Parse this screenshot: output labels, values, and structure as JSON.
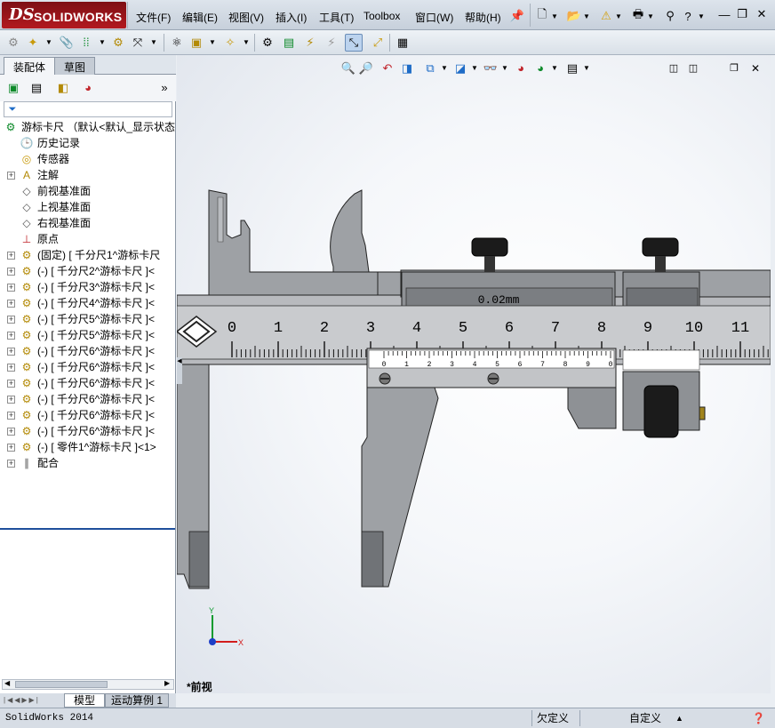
{
  "app": {
    "brand_prefix": "DS",
    "brand_name": "SOLIDWORKS"
  },
  "menu": [
    "文件(F)",
    "编辑(E)",
    "视图(V)",
    "插入(I)",
    "工具(T)",
    "Toolbox",
    "窗口(W)",
    "帮助(H)"
  ],
  "panel_tabs": [
    "装配体",
    "草图"
  ],
  "tree": {
    "root": "游标卡尺  （默认<默认_显示状态",
    "items": [
      {
        "label": "历史记录",
        "icon": "history-icon"
      },
      {
        "label": "传感器",
        "icon": "sensor-icon"
      },
      {
        "label": "注解",
        "icon": "annotation-icon"
      },
      {
        "label": "前视基准面",
        "icon": "plane-icon"
      },
      {
        "label": "上视基准面",
        "icon": "plane-icon"
      },
      {
        "label": "右视基准面",
        "icon": "plane-icon"
      },
      {
        "label": "原点",
        "icon": "origin-icon"
      },
      {
        "label": "(固定) [ 千分尺1^游标卡尺",
        "icon": "part-icon"
      },
      {
        "label": "(-) [ 千分尺2^游标卡尺 ]<",
        "icon": "part-icon"
      },
      {
        "label": "(-) [ 千分尺3^游标卡尺 ]<",
        "icon": "part-icon"
      },
      {
        "label": "(-) [ 千分尺4^游标卡尺 ]<",
        "icon": "part-icon"
      },
      {
        "label": "(-) [ 千分尺5^游标卡尺 ]<",
        "icon": "part-icon"
      },
      {
        "label": "(-) [ 千分尺5^游标卡尺 ]<",
        "icon": "part-icon"
      },
      {
        "label": "(-) [ 千分尺6^游标卡尺 ]<",
        "icon": "part-icon"
      },
      {
        "label": "(-) [ 千分尺6^游标卡尺 ]<",
        "icon": "part-icon"
      },
      {
        "label": "(-) [ 千分尺6^游标卡尺 ]<",
        "icon": "part-icon"
      },
      {
        "label": "(-) [ 千分尺6^游标卡尺 ]<",
        "icon": "part-icon"
      },
      {
        "label": "(-) [ 千分尺6^游标卡尺 ]<",
        "icon": "part-icon"
      },
      {
        "label": "(-) [ 千分尺6^游标卡尺 ]<",
        "icon": "part-icon"
      },
      {
        "label": "(-) [ 零件1^游标卡尺 ]<1>",
        "icon": "part-icon"
      },
      {
        "label": "配合",
        "icon": "mates-icon"
      }
    ]
  },
  "bottom_tabs": [
    "模型",
    "运动算例 1"
  ],
  "caliper": {
    "vernier_text": "0.02mm",
    "main_scale": [
      "0",
      "1",
      "2",
      "3",
      "4",
      "5",
      "6",
      "7",
      "8",
      "9",
      "10",
      "11"
    ],
    "vernier_scale": [
      "0",
      "1",
      "2",
      "3",
      "4",
      "5",
      "6",
      "7",
      "8",
      "9",
      "0"
    ]
  },
  "axes": {
    "x": "X",
    "y": "Y"
  },
  "view_label": "*前视",
  "status": {
    "app": "SolidWorks 2014",
    "under_defined": "欠定义",
    "custom": "自定义"
  },
  "colors": {
    "brand": "#9b1a1f",
    "selection": "#1e4f9c"
  }
}
